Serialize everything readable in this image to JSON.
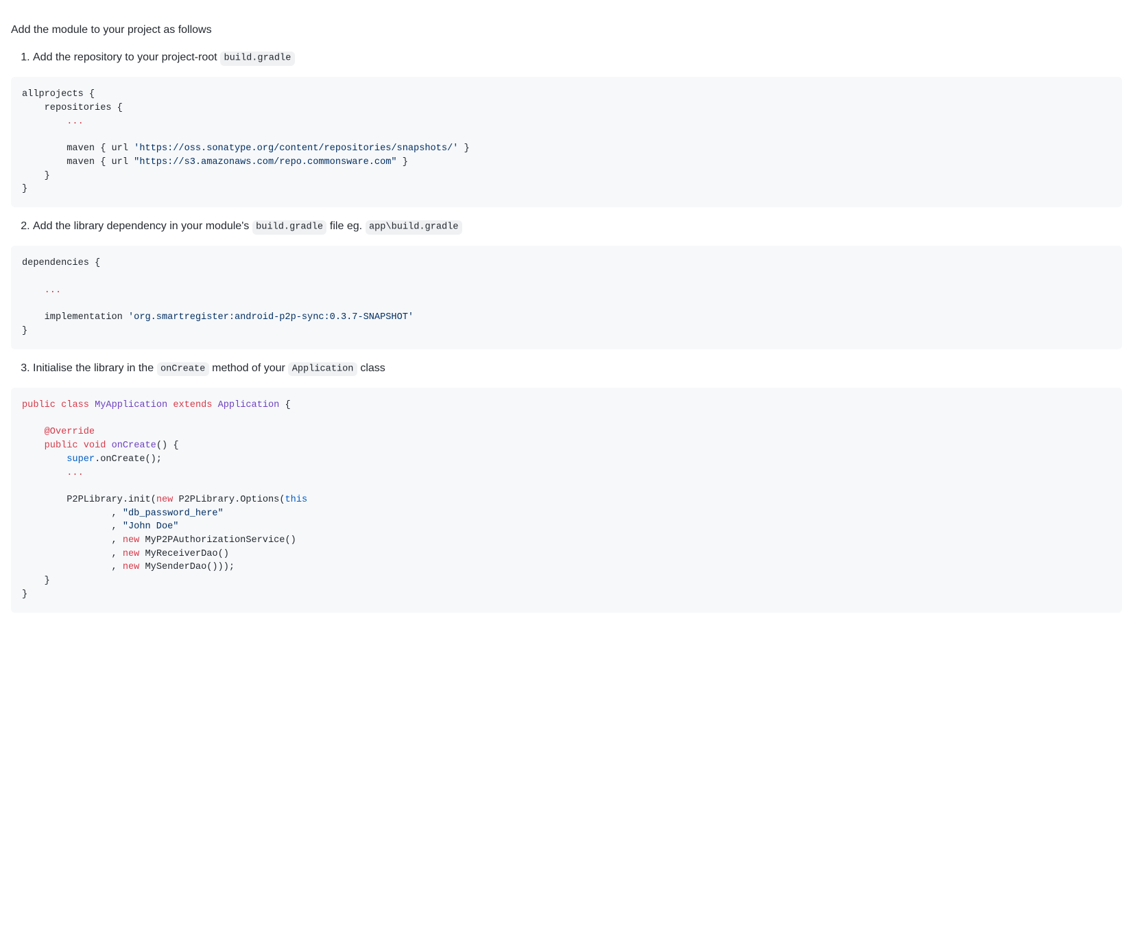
{
  "intro": "Add the module to your project as follows",
  "step1": {
    "text_before": "Add the repository to your project-root ",
    "code": "build.gradle",
    "codeblock": {
      "l1": "allprojects {",
      "l2": "    repositories {",
      "l3": "        ",
      "dots": "...",
      "l4": "",
      "l5a": "        maven { url ",
      "l5s": "'https://oss.sonatype.org/content/repositories/snapshots/'",
      "l5b": " }",
      "l6a": "        maven { url ",
      "l6s": "\"https://s3.amazonaws.com/repo.commonsware.com\"",
      "l6b": " }",
      "l7": "    }",
      "l8": "}"
    }
  },
  "step2": {
    "text_before": "Add the library dependency in your module's ",
    "code1": "build.gradle",
    "text_mid": " file eg. ",
    "code2": "app\\build.gradle",
    "codeblock": {
      "l1": "dependencies {",
      "l2": "",
      "l3pad": "    ",
      "dots": "...",
      "l4": "",
      "l5a": "    implementation ",
      "l5s": "'org.smartregister:android-p2p-sync:0.3.7-SNAPSHOT'",
      "l6": "}"
    }
  },
  "step3": {
    "text_before": "Initialise the library in the ",
    "code1": "onCreate",
    "text_mid": " method of your ",
    "code2": "Application",
    "text_after": " class",
    "codeblock": {
      "kw_public": "public",
      "kw_class": "class",
      "kw_void": "void",
      "kw_extends": "extends",
      "kw_new": "new",
      "kw_this": "this",
      "kw_super": "super",
      "cls_MyApplication": "MyApplication",
      "cls_Application": "Application",
      "ann_Override": "@Override",
      "fn_onCreate": "onCreate",
      "s_dbpass": "\"db_password_here\"",
      "s_john": "\"John Doe\"",
      "t_P2PLibrary": "P2PLibrary",
      "t_init": "init",
      "t_Options": "Options",
      "t_MyP2PAuth": "MyP2PAuthorizationService",
      "t_MyReceiver": "MyReceiverDao",
      "t_MySender": "MySenderDao",
      "dots": "..."
    }
  }
}
